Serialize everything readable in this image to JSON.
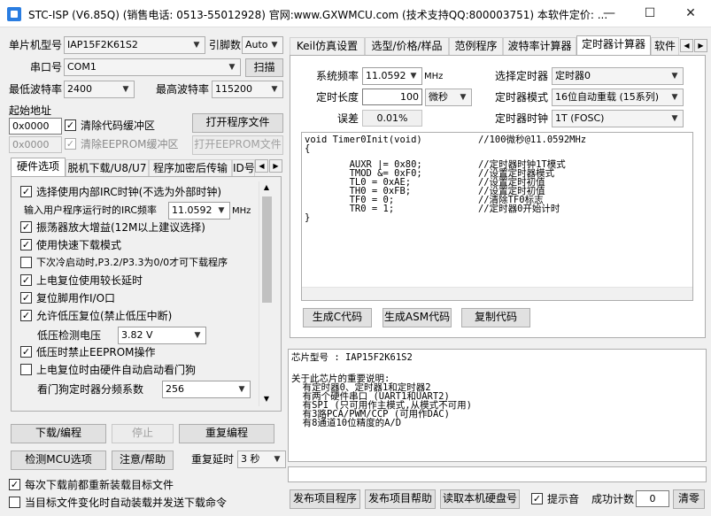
{
  "window": {
    "title": "STC-ISP (V6.85Q) (销售电话: 0513-55012928) 官网:www.GXWMCU.com  (技术支持QQ:800003751) 本软件定价: ...",
    "minimize": "—",
    "maximize": "☐",
    "close": "✕"
  },
  "left": {
    "mcu_label": "单片机型号",
    "mcu_value": "IAP15F2K61S2",
    "pin_label": "引脚数",
    "pin_value": "Auto",
    "port_label": "串口号",
    "port_value": "COM1",
    "scan_btn": "扫描",
    "min_baud_label": "最低波特率",
    "min_baud_value": "2400",
    "max_baud_label": "最高波特率",
    "max_baud_value": "115200",
    "start_addr_label": "起始地址",
    "addr1": "0x0000",
    "clear_code_label": "清除代码缓冲区",
    "open_prog_btn": "打开程序文件",
    "addr2": "0x0000",
    "clear_eeprom_label": "清除EEPROM缓冲区",
    "open_eeprom_btn": "打开EEPROM文件",
    "tabs": [
      "硬件选项",
      "脱机下载/U8/U7",
      "程序加密后传输",
      "ID号"
    ],
    "options": [
      {
        "label": "选择使用内部IRC时钟(不选为外部时钟)",
        "checked": "✓"
      },
      {
        "label": "振荡器放大增益(12M以上建议选择)",
        "checked": "✓"
      },
      {
        "label": "使用快速下载模式",
        "checked": "✓"
      },
      {
        "label": "下次冷启动时,P3.2/P3.3为0/0才可下载程序",
        "checked": ""
      },
      {
        "label": "上电复位使用较长延时",
        "checked": "✓"
      },
      {
        "label": "复位脚用作I/O口",
        "checked": "✓"
      },
      {
        "label": "允许低压复位(禁止低压中断)",
        "checked": "✓"
      },
      {
        "label": "低压时禁止EEPROM操作",
        "checked": "✓"
      },
      {
        "label": "上电复位时由硬件自动启动看门狗",
        "checked": ""
      }
    ],
    "irc_label": "输入用户程序运行时的IRC频率",
    "irc_value": "11.0592",
    "irc_unit": "MHz",
    "lv_label": "低压检测电压",
    "lv_value": "3.82 V",
    "wdt_label": "看门狗定时器分频系数",
    "wdt_value": "256",
    "download_btn": "下载/编程",
    "stop_btn": "停止",
    "reprogram_btn": "重复编程",
    "check_btn": "检测MCU选项",
    "help_btn": "注意/帮助",
    "retry_label": "重复延时",
    "retry_value": "3 秒",
    "reload_label": "每次下载前都重新装载目标文件",
    "auto_send_label": "当目标文件变化时自动装载并发送下载命令"
  },
  "right": {
    "tabs": [
      "Keil仿真设置",
      "选型/价格/样品",
      "范例程序",
      "波特率计算器",
      "定时器计算器",
      "软件"
    ],
    "sysfreq_label": "系统频率",
    "sysfreq_value": "11.0592",
    "sysfreq_unit": "MHz",
    "timer_sel_label": "选择定时器",
    "timer_sel_value": "定时器0",
    "len_label": "定时长度",
    "len_value": "100",
    "len_unit": "微秒",
    "mode_label": "定时器模式",
    "mode_value": "16位自动重载 (15系列)",
    "err_label": "误差",
    "err_value": "0.01%",
    "clk_label": "定时器时钟",
    "clk_value": "1T  (FOSC)",
    "code": [
      "void Timer0Init(void)          //100微秒@11.0592MHz",
      "{",
      "        AUXR |= 0x80;          //定时器时钟1T模式",
      "        TMOD &= 0xF0;          //设置定时器模式",
      "        TL0 = 0xAE;            //设置定时初值",
      "        TH0 = 0xFB;            //设置定时初值",
      "        TF0 = 0;               //清除TF0标志",
      "        TR0 = 1;               //定时器0开始计时",
      "}"
    ],
    "gen_c_btn": "生成C代码",
    "gen_asm_btn": "生成ASM代码",
    "copy_btn": "复制代码",
    "info": [
      "芯片型号 : IAP15F2K61S2",
      "",
      "关于此芯片的重要说明:",
      "  有定时器0、定时器1和定时器2",
      "  有两个硬件串口 (UART1和UART2)",
      "  有SPI (只可用作主模式,从模式不可用)",
      "  有3路PCA/PWM/CCP (可用作DAC)",
      "  有8通道10位精度的A/D"
    ],
    "publish_btn": "发布项目程序",
    "publish_help_btn": "发布项目帮助",
    "read_disk_btn": "读取本机硬盘号",
    "sound_label": "提示音",
    "count_label": "成功计数",
    "count_value": "0",
    "clear_btn": "清零"
  }
}
